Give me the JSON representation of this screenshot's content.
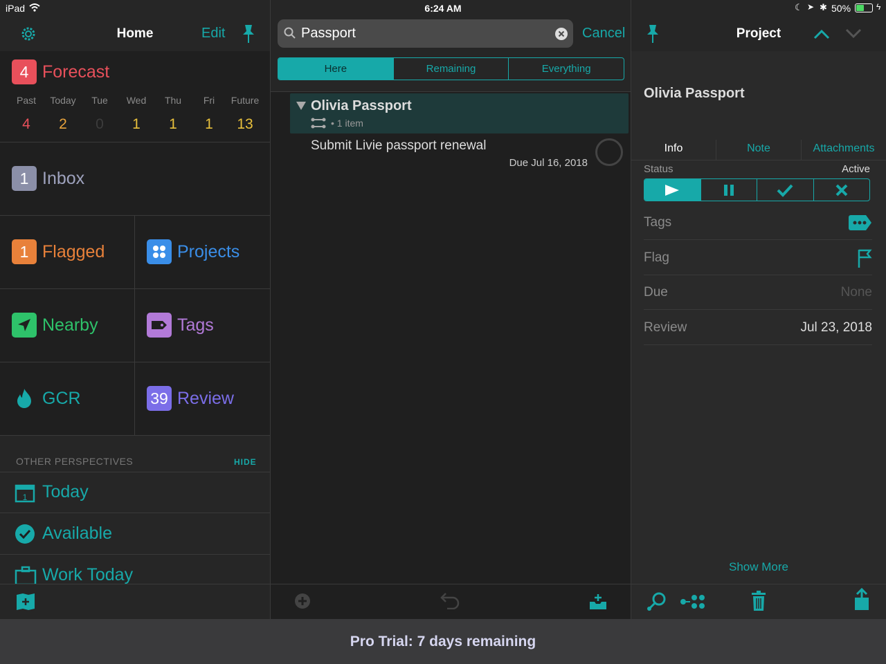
{
  "status_bar": {
    "device": "iPad",
    "time": "6:24 AM",
    "battery": "50%"
  },
  "left": {
    "header": {
      "title": "Home",
      "edit": "Edit"
    },
    "forecast": {
      "badge": "4",
      "label": "Forecast",
      "days": [
        {
          "name": "Past",
          "count": "4",
          "color": "#e8505b"
        },
        {
          "name": "Today",
          "count": "2",
          "color": "#e8a33c"
        },
        {
          "name": "Tue",
          "count": "0",
          "color": "#3c3c3c"
        },
        {
          "name": "Wed",
          "count": "1",
          "color": "#e8c03c"
        },
        {
          "name": "Thu",
          "count": "1",
          "color": "#e8c03c"
        },
        {
          "name": "Fri",
          "count": "1",
          "color": "#e8c03c"
        },
        {
          "name": "Future",
          "count": "13",
          "color": "#e8c03c"
        }
      ]
    },
    "inbox": {
      "badge": "1",
      "label": "Inbox"
    },
    "flagged": {
      "badge": "1",
      "label": "Flagged"
    },
    "projects": {
      "label": "Projects"
    },
    "nearby": {
      "label": "Nearby"
    },
    "tags": {
      "label": "Tags"
    },
    "gcr": {
      "label": "GCR"
    },
    "review": {
      "badge": "39",
      "label": "Review"
    },
    "other": {
      "heading": "OTHER PERSPECTIVES",
      "hide": "HIDE"
    },
    "perspectives": {
      "today": "Today",
      "available": "Available",
      "work_today": "Work Today"
    }
  },
  "mid": {
    "search": {
      "value": "Passport",
      "cancel": "Cancel"
    },
    "scope": [
      "Here",
      "Remaining",
      "Everything"
    ],
    "project": {
      "title": "Olivia Passport",
      "meta": "• 1 item"
    },
    "task": {
      "title": "Submit Livie passport renewal",
      "due": "Due Jul 16, 2018"
    }
  },
  "right": {
    "header": {
      "title": "Project"
    },
    "name": "Olivia Passport",
    "tabs": [
      "Info",
      "Note",
      "Attachments"
    ],
    "status": {
      "label": "Status",
      "value": "Active"
    },
    "rows": {
      "tags": "Tags",
      "flag": "Flag",
      "due": "Due",
      "due_value": "None",
      "review": "Review",
      "review_value": "Jul 23, 2018"
    },
    "show_more": "Show More"
  },
  "trial": "Pro Trial: 7 days remaining",
  "colors": {
    "accent": "#17a9a9",
    "forecast": "#e8505b",
    "inbox": "#8b8fa8",
    "flagged": "#e8813a",
    "projects": "#3a8ee8",
    "nearby": "#2ec26a",
    "tags": "#b27ad8",
    "review": "#7b6ee8"
  }
}
